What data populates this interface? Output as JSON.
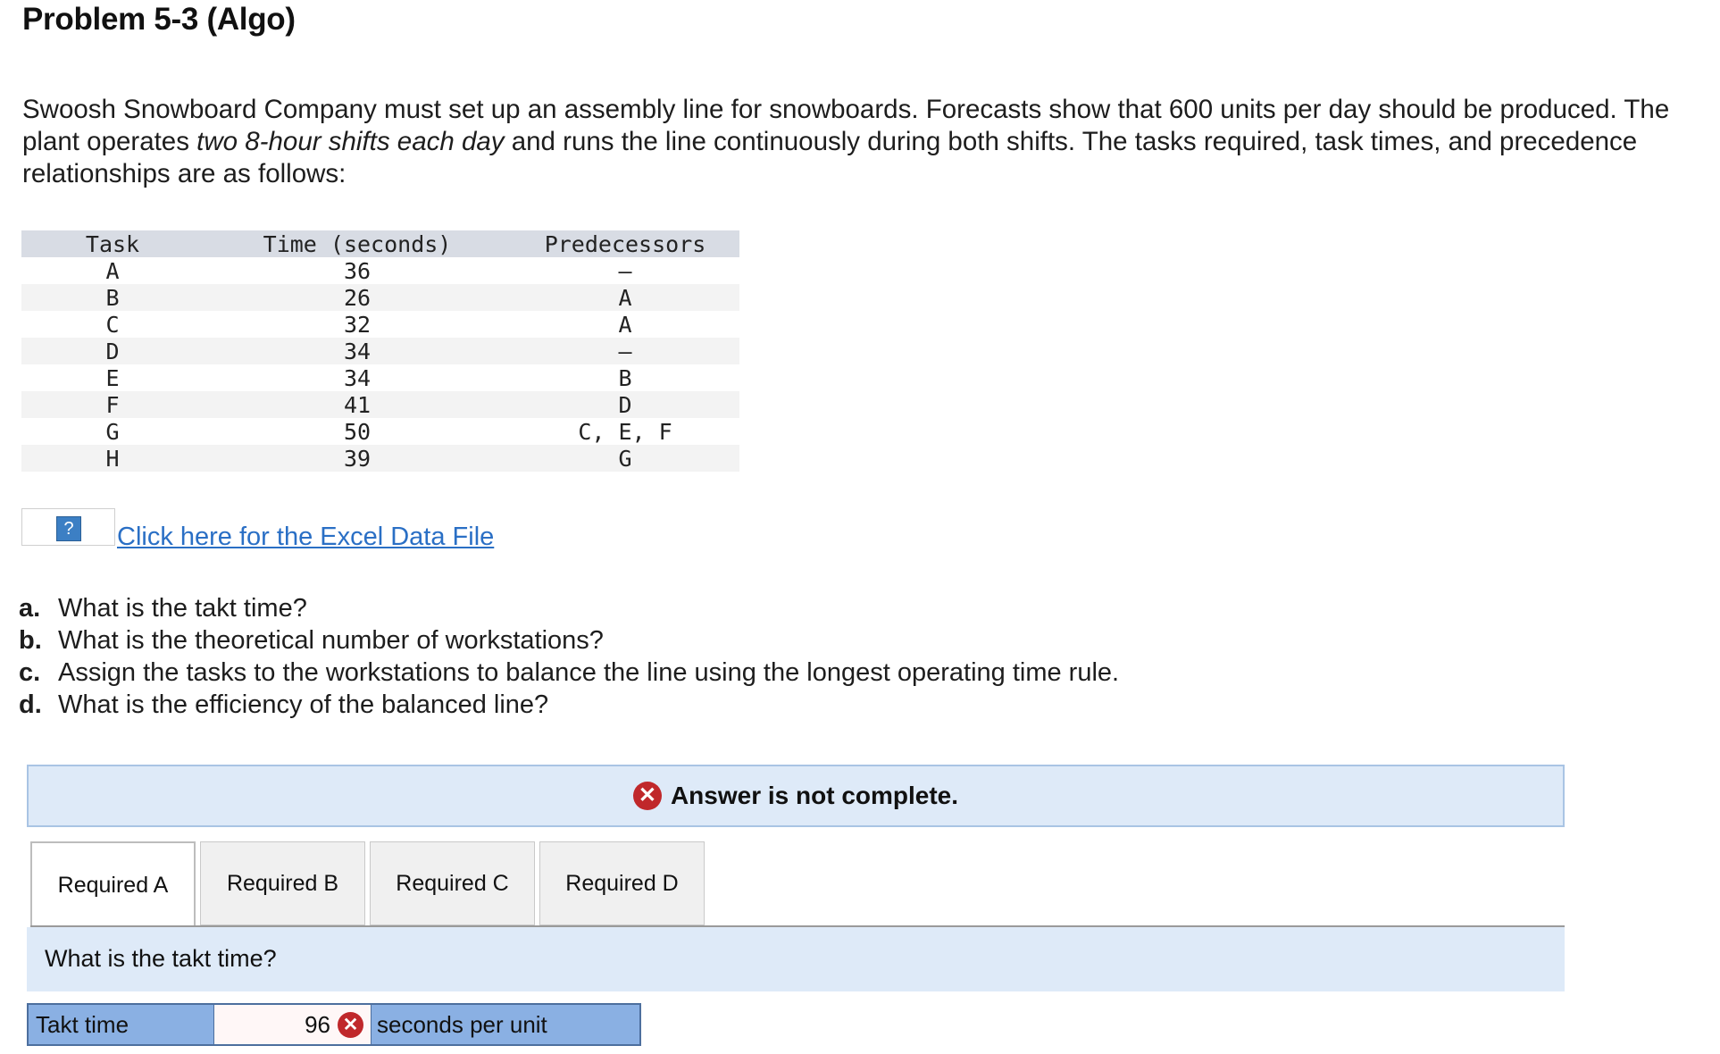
{
  "title": "Problem 5-3 (Algo)",
  "intro": {
    "part1": "Swoosh Snowboard Company must set up an assembly line for snowboards. Forecasts show that 600 units per day should be produced. The plant operates ",
    "emphasis": "two 8-hour shifts each day",
    "part2": " and runs the line continuously during both shifts. The tasks required, task times, and precedence relationships are as follows:"
  },
  "task_table": {
    "headers": [
      "Task",
      "Time (seconds)",
      "Predecessors"
    ],
    "rows": [
      [
        "A",
        "36",
        "—"
      ],
      [
        "B",
        "26",
        "A"
      ],
      [
        "C",
        "32",
        "A"
      ],
      [
        "D",
        "34",
        "—"
      ],
      [
        "E",
        "34",
        "B"
      ],
      [
        "F",
        "41",
        "D"
      ],
      [
        "G",
        "50",
        "C, E, F"
      ],
      [
        "H",
        "39",
        "G"
      ]
    ]
  },
  "help_icon_label": "?",
  "excel_link": "Click here for the Excel Data File",
  "questions": [
    {
      "letter": "a.",
      "text": "What is the takt time?"
    },
    {
      "letter": "b.",
      "text": "What is the theoretical number of workstations?"
    },
    {
      "letter": "c.",
      "text": "Assign the tasks to the workstations to balance the line using the longest operating time rule."
    },
    {
      "letter": "d.",
      "text": "What is the efficiency of the balanced line?"
    }
  ],
  "status": {
    "icon": "✕",
    "text": "Answer is not complete."
  },
  "tabs": [
    "Required A",
    "Required B",
    "Required C",
    "Required D"
  ],
  "active_tab": "Required A",
  "panel_question": "What is the takt time?",
  "answer": {
    "label": "Takt time",
    "value": "96",
    "mark": "✕",
    "unit": "seconds per unit"
  },
  "colors": {
    "error_red": "#c0282b",
    "banner_bg": "#deeaf8",
    "label_cell_bg": "#8ab0e3",
    "link_blue": "#2a6fc5"
  }
}
